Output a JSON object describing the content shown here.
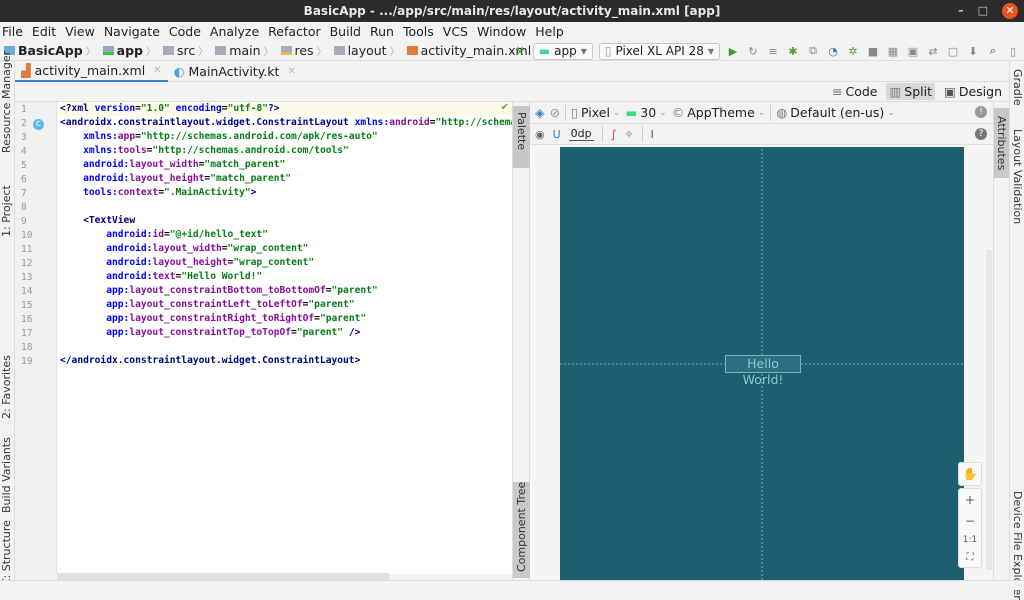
{
  "window": {
    "title": "BasicApp - .../app/src/main/res/layout/activity_main.xml [app]",
    "minimize": "–",
    "maximize": "□",
    "close": "✕"
  },
  "menu": [
    "File",
    "Edit",
    "View",
    "Navigate",
    "Code",
    "Analyze",
    "Refactor",
    "Build",
    "Run",
    "Tools",
    "VCS",
    "Window",
    "Help"
  ],
  "breadcrumb": [
    "BasicApp",
    "app",
    "src",
    "main",
    "res",
    "layout",
    "activity_main.xml"
  ],
  "toolbar": {
    "run_config": "app",
    "device": "Pixel XL API 28"
  },
  "tabs": [
    {
      "label": "activity_main.xml",
      "active": true
    },
    {
      "label": "MainActivity.kt",
      "active": false
    }
  ],
  "view_modes": {
    "code": "Code",
    "split": "Split",
    "design": "Design",
    "selected": "Split"
  },
  "editor": {
    "line_numbers": [
      "1",
      "2",
      "3",
      "4",
      "5",
      "6",
      "7",
      "8",
      "9",
      "10",
      "11",
      "12",
      "13",
      "14",
      "15",
      "16",
      "17",
      "18",
      "19"
    ],
    "lines": [
      "<?xml version=\"1.0\" encoding=\"utf-8\"?>",
      "<androidx.constraintlayout.widget.ConstraintLayout xmlns:android=\"http://schemas.andro",
      "    xmlns:app=\"http://schemas.android.com/apk/res-auto\"",
      "    xmlns:tools=\"http://schemas.android.com/tools\"",
      "    android:layout_width=\"match_parent\"",
      "    android:layout_height=\"match_parent\"",
      "    tools:context=\".MainActivity\">",
      "",
      "    <TextView",
      "        android:id=\"@+id/hello_text\"",
      "        android:layout_width=\"wrap_content\"",
      "        android:layout_height=\"wrap_content\"",
      "        android:text=\"Hello World!\"",
      "        app:layout_constraintBottom_toBottomOf=\"parent\"",
      "        app:layout_constraintLeft_toLeftOf=\"parent\"",
      "        app:layout_constraintRight_toRightOf=\"parent\"",
      "        app:layout_constraintTop_toTopOf=\"parent\" />",
      "",
      "</androidx.constraintlayout.widget.ConstraintLayout>"
    ]
  },
  "design": {
    "device": "Pixel",
    "api": "30",
    "theme": "AppTheme",
    "locale": "Default (en-us)",
    "margin": "0dp",
    "preview_text": "Hello World!",
    "screen_color": "#1d5e6f",
    "zoom_fit_label": "1:1"
  },
  "side_panels": {
    "left": [
      "Resource Manager",
      "1: Project",
      "2: Favorites",
      "Build Variants",
      "Z: Structure"
    ],
    "right": [
      "Gradle",
      "Layout Validation",
      "Device File Explorer"
    ],
    "palette": "Palette",
    "component_tree": "Component Tree",
    "attributes": "Attributes"
  }
}
